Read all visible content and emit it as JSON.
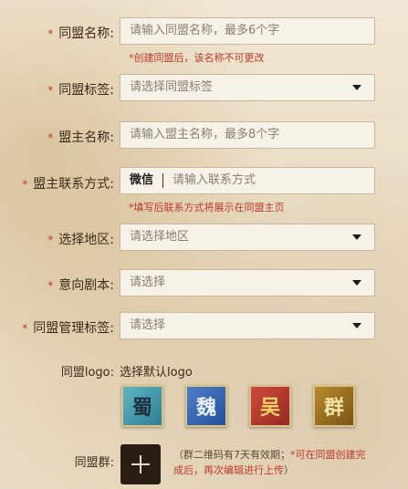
{
  "form": {
    "alliance_name": {
      "label": "同盟名称:",
      "placeholder": "请输入同盟名称，最多6个字",
      "hint": "*创建同盟后，该名称不可更改"
    },
    "alliance_tag": {
      "label": "同盟标签:",
      "placeholder": "请选择同盟标签"
    },
    "leader_name": {
      "label": "盟主名称:",
      "placeholder": "请输入盟主名称，最多8个字"
    },
    "contact": {
      "label": "盟主联系方式:",
      "prefix": "微信",
      "placeholder": "请输入联系方式",
      "hint": "*填写后联系方式将展示在同盟主页"
    },
    "region": {
      "label": "选择地区:",
      "placeholder": "请选择地区"
    },
    "script": {
      "label": "意向剧本:",
      "placeholder": "请选择"
    },
    "mgmt_tag": {
      "label": "同盟管理标签:",
      "placeholder": "请选择"
    },
    "required_mark": "*"
  },
  "logo": {
    "label": "同盟logo:",
    "sub_label": "选择默认logo",
    "options": [
      "蜀",
      "魏",
      "吴",
      "群"
    ]
  },
  "group": {
    "label": "同盟群:",
    "note_prefix": "（群二维码有7天有效期；",
    "note_red": "*可在同盟创建完成后，再次编辑进行上传",
    "note_suffix": "）"
  },
  "colors": {
    "required": "#c0392b",
    "field_bg": "#f7f2e8",
    "button_bg": "#2a1d14"
  }
}
